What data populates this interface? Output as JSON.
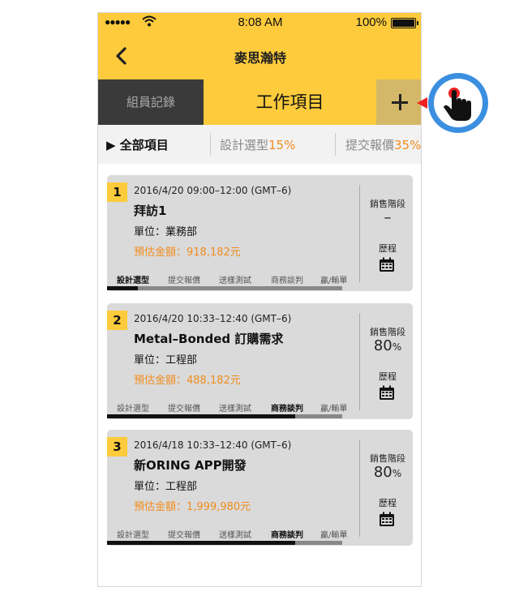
{
  "status_bar": {
    "signal": "●●●●●",
    "time": "8:08 AM",
    "battery": "100%"
  },
  "nav": {
    "title": "麥思瀚特",
    "back_icon": "chevron-left-icon"
  },
  "tabs": {
    "records": "組員記錄",
    "work_items": "工作項目",
    "add_icon": "plus-icon"
  },
  "filters": {
    "all": "▶ 全部項目",
    "design": "設計選型",
    "design_pct": "15%",
    "submit": "提交報價",
    "submit_pct": "35%"
  },
  "stages": [
    "設計選型",
    "提交報價",
    "送樣測試",
    "商務談判",
    "贏/輸單"
  ],
  "sales_stage_label": "銷售階段",
  "history_label": "歷程",
  "cards": [
    {
      "num": "1",
      "time": "2016/4/20 09:00–12:00 (GMT–6)",
      "title": "拜訪1",
      "unit": "單位：業務部",
      "amount": "預估金額：918,182元",
      "stage_value": "–",
      "stage_unit": "",
      "active_stage": 0,
      "progress": 0.13
    },
    {
      "num": "2",
      "time": "2016/4/20 10:33–12:40 (GMT–6)",
      "title": "Metal–Bonded 訂購需求",
      "unit": "單位：工程部",
      "amount": "預估金額：488,182元",
      "stage_value": "80",
      "stage_unit": "%",
      "active_stage": 3,
      "progress": 0.8
    },
    {
      "num": "3",
      "time": "2016/4/18 10:33–12:40 (GMT–6)",
      "title": "新ORING APP開發",
      "unit": "單位：工程部",
      "amount": "預估金額：1,999,980元",
      "stage_value": "80",
      "stage_unit": "%",
      "active_stage": 3,
      "progress": 0.8
    }
  ],
  "colors": {
    "accent": "#fdcb3b",
    "amount": "#f08c1e",
    "dark_tab": "#3a3a3a",
    "touch": "#3b8fe0"
  }
}
